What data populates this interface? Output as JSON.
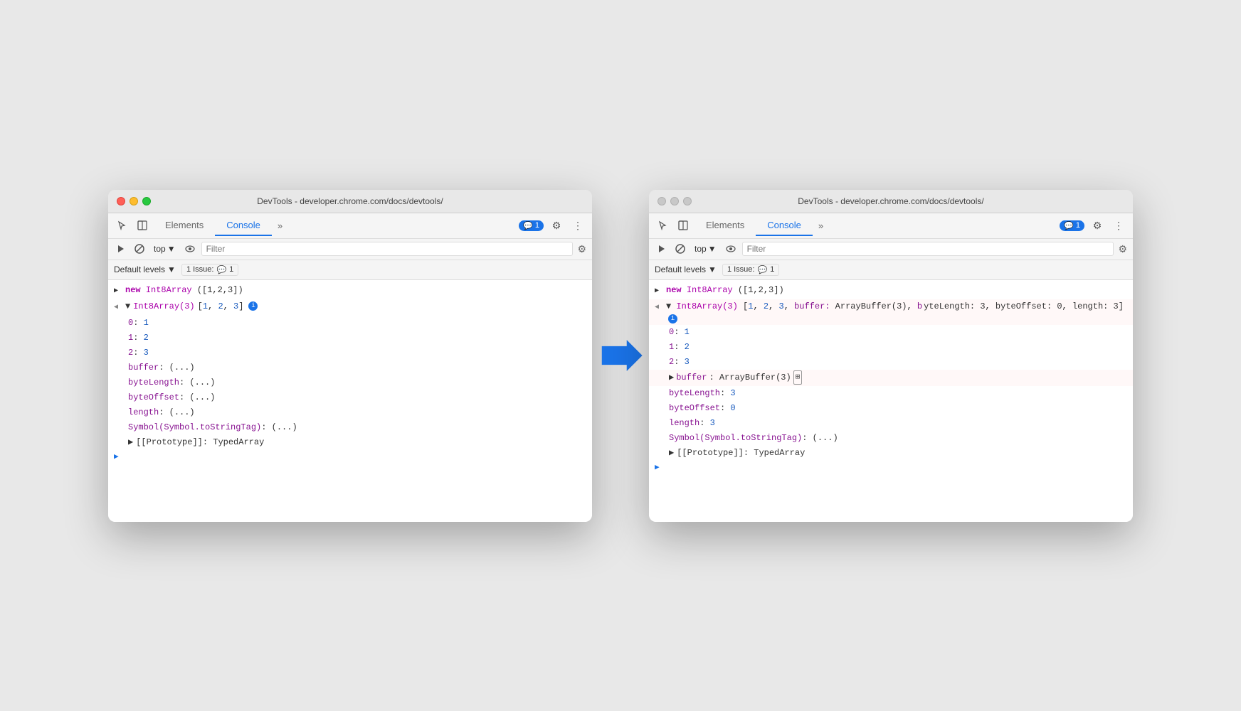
{
  "left_window": {
    "title": "DevTools - developer.chrome.com/docs/devtools/",
    "traffic_lights": [
      "red",
      "yellow",
      "green"
    ],
    "tabs": [
      "Elements",
      "Console",
      ">>"
    ],
    "active_tab": "Console",
    "badge": "1",
    "console_top": "top",
    "filter_placeholder": "Filter",
    "default_levels": "Default levels",
    "issues": "1 Issue:",
    "issue_count": "1",
    "lines": [
      {
        "indent": 0,
        "arrow": "▶",
        "content": "new Int8Array([1,2,3])"
      },
      {
        "indent": 0,
        "arrow": "◀",
        "content": ""
      },
      {
        "indent": 0,
        "arrow": "▼",
        "content": "Int8Array(3) [1, 2, 3]"
      },
      {
        "indent": 1,
        "arrow": "",
        "content": "0: 1"
      },
      {
        "indent": 1,
        "arrow": "",
        "content": "1: 2"
      },
      {
        "indent": 1,
        "arrow": "",
        "content": "2: 3"
      },
      {
        "indent": 1,
        "arrow": "",
        "content": "buffer: (...)"
      },
      {
        "indent": 1,
        "arrow": "",
        "content": "byteLength: (...)"
      },
      {
        "indent": 1,
        "arrow": "",
        "content": "byteOffset: (...)"
      },
      {
        "indent": 1,
        "arrow": "",
        "content": "length: (...)"
      },
      {
        "indent": 1,
        "arrow": "",
        "content": "Symbol(Symbol.toStringTag): (...)"
      },
      {
        "indent": 1,
        "arrow": "▶",
        "content": "[[Prototype]]: TypedArray"
      }
    ],
    "prompt": ">"
  },
  "right_window": {
    "title": "DevTools - developer.chrome.com/docs/devtools/",
    "traffic_lights": [
      "inactive",
      "inactive",
      "inactive"
    ],
    "tabs": [
      "Elements",
      "Console",
      ">>"
    ],
    "active_tab": "Console",
    "badge": "1",
    "console_top": "top",
    "filter_placeholder": "Filter",
    "default_levels": "Default levels",
    "issues": "1 Issue:",
    "issue_count": "1",
    "lines": [
      {
        "indent": 0,
        "arrow": "▶",
        "content_type": "new_int8",
        "content": "new Int8Array([1,2,3])"
      },
      {
        "indent": 0,
        "arrow": "◀",
        "content_type": "expanded_header",
        "content": "Int8Array(3) [1, 2, 3, buffer: ArrayBuffer(3), byteLength: 3, byteOffset: 0, length: 3]"
      },
      {
        "indent": 1,
        "arrow": "",
        "content_type": "kv",
        "key": "0",
        "val": "1"
      },
      {
        "indent": 1,
        "arrow": "",
        "content_type": "kv",
        "key": "1",
        "val": "2"
      },
      {
        "indent": 1,
        "arrow": "",
        "content_type": "kv",
        "key": "2",
        "val": "3"
      },
      {
        "indent": 1,
        "arrow": "▶",
        "content_type": "buffer",
        "content": "buffer: ArrayBuffer(3)"
      },
      {
        "indent": 1,
        "arrow": "",
        "content_type": "kv_plain",
        "content": "byteLength: 3"
      },
      {
        "indent": 1,
        "arrow": "",
        "content_type": "kv_plain",
        "content": "byteOffset: 0"
      },
      {
        "indent": 1,
        "arrow": "",
        "content_type": "kv_plain",
        "content": "length: 3"
      },
      {
        "indent": 1,
        "arrow": "",
        "content_type": "sym",
        "content": "Symbol(Symbol.toStringTag): (...)"
      },
      {
        "indent": 1,
        "arrow": "▶",
        "content_type": "proto",
        "content": "[[Prototype]]: TypedArray"
      }
    ],
    "prompt": ">"
  },
  "arrow": {
    "color": "#1a73e8"
  }
}
